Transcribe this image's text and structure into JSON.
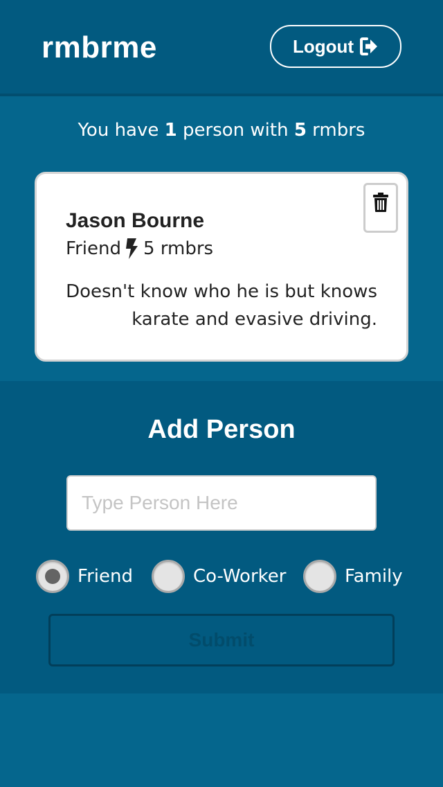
{
  "colors": {
    "background": "#05668d",
    "header_bg": "#025a80",
    "card_bg": "#ffffff",
    "submit_border": "#023f5a"
  },
  "header": {
    "brand": "rmbrme",
    "logout_label": "Logout",
    "logout_icon": "sign-out-icon"
  },
  "summary": {
    "prefix": "You have",
    "person_count": "1",
    "middle": "person with",
    "rmbr_count": "5",
    "suffix": "rmbrs"
  },
  "people": [
    {
      "name": "Jason Bourne",
      "relation": "Friend",
      "rmbrs_label": "5 rmbrs",
      "note": "Doesn't know who he is but knows karate and evasive driving.",
      "delete_icon": "trash-icon",
      "rmbr_icon": "bolt-icon"
    }
  ],
  "add_person": {
    "title": "Add Person",
    "input_placeholder": "Type Person Here",
    "input_value": "",
    "options": [
      {
        "label": "Friend",
        "checked": true
      },
      {
        "label": "Co-Worker",
        "checked": false
      },
      {
        "label": "Family",
        "checked": false
      }
    ],
    "submit_label": "Submit"
  }
}
